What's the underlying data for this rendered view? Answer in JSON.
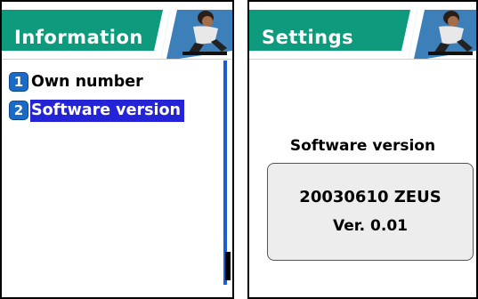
{
  "left_screen": {
    "title": "Information",
    "menu": [
      {
        "number": "1",
        "label": "Own number",
        "selected": false
      },
      {
        "number": "2",
        "label": "Software version",
        "selected": true
      }
    ]
  },
  "right_screen": {
    "title": "Settings",
    "heading": "Software version",
    "version_line1": "20030610 ZEUS",
    "version_line2": "Ver. 0.01"
  },
  "colors": {
    "title_band": "#0e9b7d",
    "selection": "#2424d6",
    "scrollbar": "#1a5fd0",
    "number_badge": "#1a6bc7"
  },
  "icons": {
    "title_image": "skateboarder-photo-icon"
  }
}
